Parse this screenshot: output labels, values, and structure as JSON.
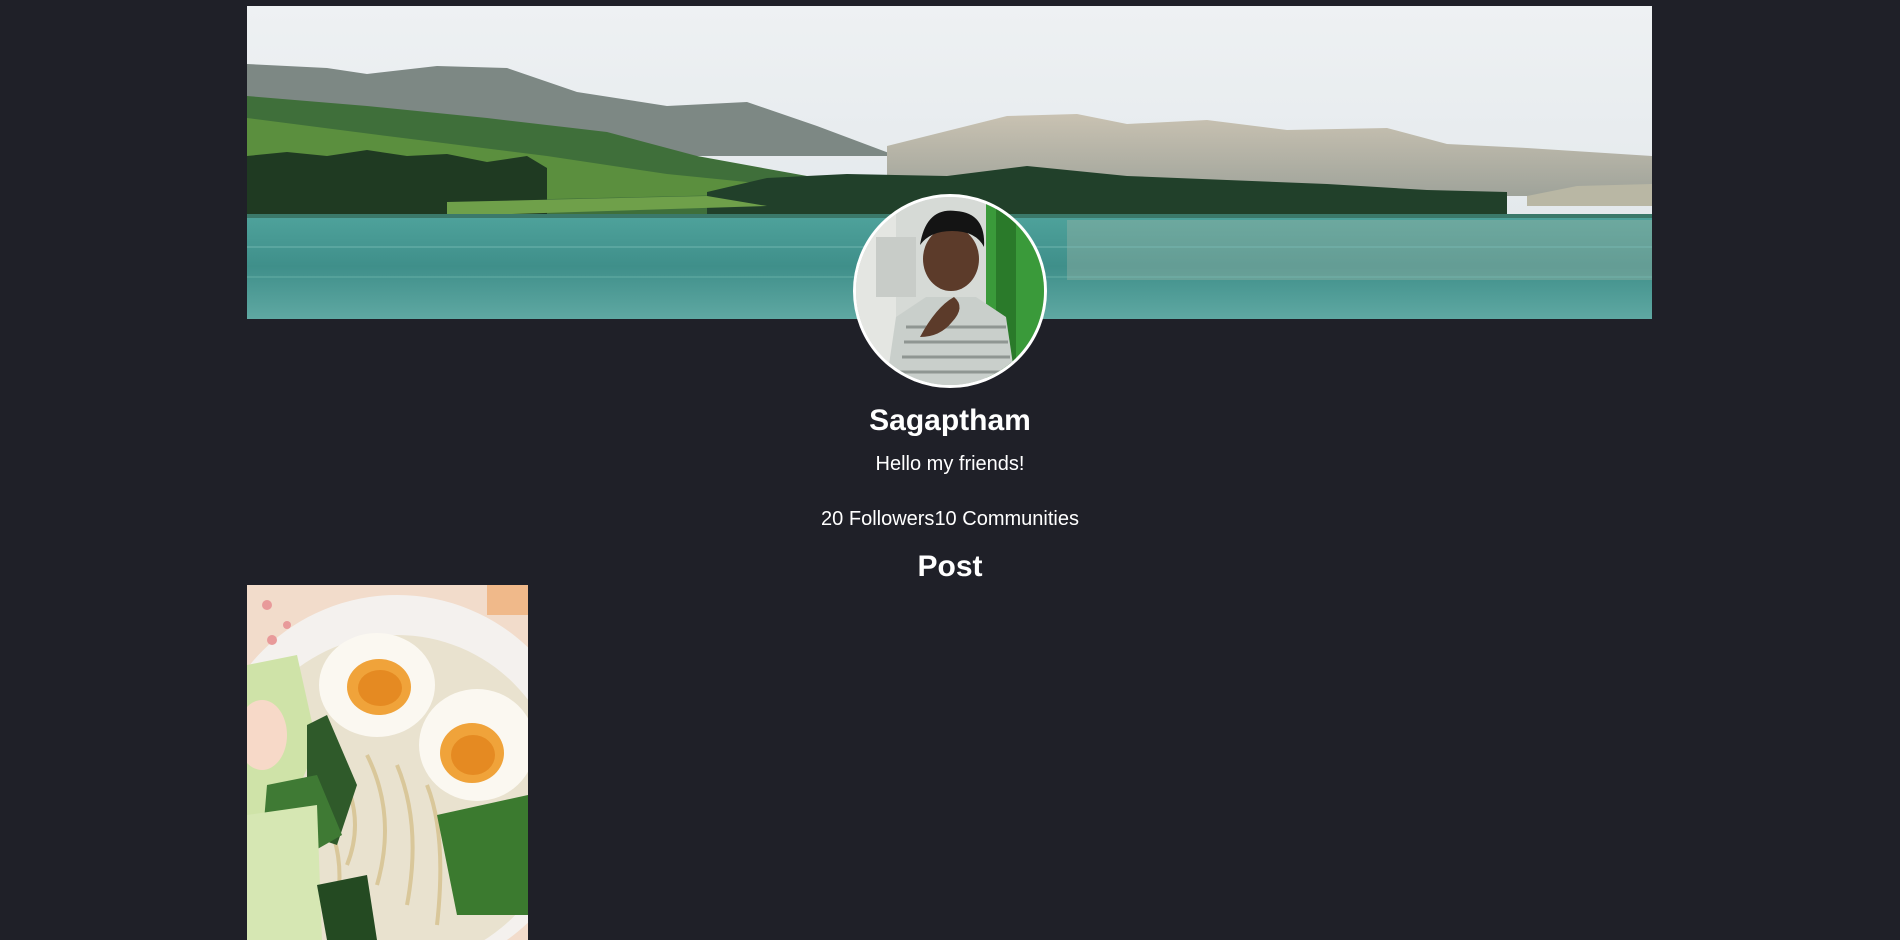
{
  "profile": {
    "name": "Sagaptham",
    "bio": "Hello my friends!",
    "followers_count": "20",
    "followers_label": "Followers",
    "communities_count": "10",
    "communities_label": "Communities"
  },
  "posts_section": {
    "title": "Post"
  },
  "colors": {
    "background": "#1f2028",
    "text": "#ffffff"
  }
}
